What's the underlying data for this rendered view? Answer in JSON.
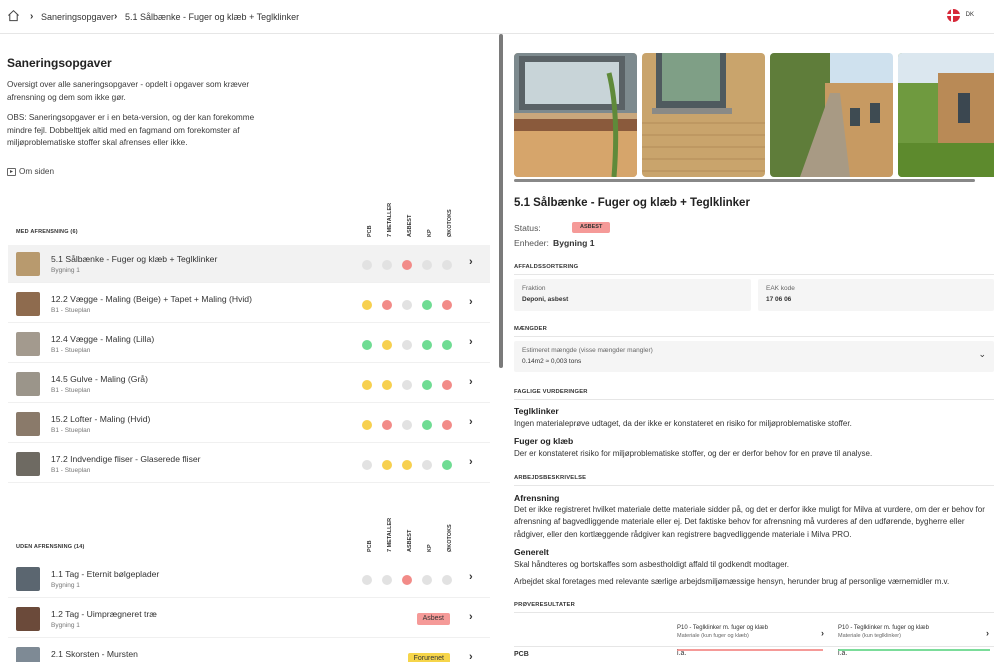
{
  "breadcrumb": {
    "home_icon": "home-icon",
    "items": [
      "Saneringsopgaver",
      "5.1 Sålbænke - Fuger og klæb + Teglklinker"
    ]
  },
  "lang": {
    "flag": "denmark-flag-icon",
    "label": "DK"
  },
  "left": {
    "title": "Saneringsopgaver",
    "intro1": "Oversigt over alle saneringsopgaver - opdelt i opgaver som kræver afrensning og dem som ikke gør.",
    "intro2": "OBS: Saneringsopgaver er i en beta-version, og der kan forekomme mindre fejl. Dobbelttjek altid med en fagmand om forekomster af miljøproblematiske stoffer skal afrenses eller ikke.",
    "about": "Om siden",
    "columns": [
      "PCB",
      "7 METALLER",
      "ASBEST",
      "KP",
      "ØKOTOKS"
    ],
    "with_cleaning": {
      "title": "MED AFRENSNING (6)",
      "rows": [
        {
          "title": "5.1 Sålbænke - Fuger og klæb + Teglklinker",
          "sub": "Bygning 1",
          "dots": [
            "gray",
            "gray",
            "red",
            "gray",
            "gray"
          ],
          "selected": true,
          "thumb": "#b89a6e"
        },
        {
          "title": "12.2 Vægge - Maling (Beige) + Tapet + Maling (Hvid)",
          "sub": "B1 - Stueplan",
          "dots": [
            "yellow",
            "red",
            "gray",
            "green",
            "red"
          ],
          "selected": false,
          "thumb": "#8e6b4e"
        },
        {
          "title": "12.4 Vægge - Maling (Lilla)",
          "sub": "B1 - Stueplan",
          "dots": [
            "green",
            "yellow",
            "gray",
            "green",
            "green"
          ],
          "selected": false,
          "thumb": "#a39a8e"
        },
        {
          "title": "14.5 Gulve - Maling (Grå)",
          "sub": "B1 - Stueplan",
          "dots": [
            "yellow",
            "yellow",
            "gray",
            "green",
            "red"
          ],
          "selected": false,
          "thumb": "#9b958a"
        },
        {
          "title": "15.2 Lofter - Maling (Hvid)",
          "sub": "B1 - Stueplan",
          "dots": [
            "yellow",
            "red",
            "gray",
            "green",
            "red"
          ],
          "selected": false,
          "thumb": "#8a7a6a"
        },
        {
          "title": "17.2 Indvendige fliser - Glaserede fliser",
          "sub": "B1 - Stueplan",
          "dots": [
            "gray",
            "yellow",
            "yellow",
            "gray",
            "green"
          ],
          "selected": false,
          "thumb": "#6e6a62"
        }
      ]
    },
    "without_cleaning": {
      "title": "UDEN AFRENSNING (14)",
      "rows": [
        {
          "title": "1.1 Tag - Eternit bølgeplader",
          "sub": "Bygning 1",
          "dots": [
            "gray",
            "gray",
            "red",
            "gray",
            "gray"
          ],
          "badge": null,
          "thumb": "#5b6670"
        },
        {
          "title": "1.2 Tag - Uimprægneret træ",
          "sub": "Bygning 1",
          "dots": [],
          "badge": "Asbest",
          "badge_color": "#f59a98",
          "thumb": "#6b4a3a"
        },
        {
          "title": "2.1 Skorsten - Mursten",
          "sub": "",
          "dots": [],
          "badge": "Forurenet",
          "badge_color": "#f6d54a",
          "thumb": "#7e8a95"
        }
      ]
    }
  },
  "right": {
    "title": "5.1 Sålbænke - Fuger og klæb + Teglklinker",
    "status_label": "Status:",
    "status_value": "ASBEST",
    "units_label": "Enheder:",
    "units_value": "Bygning 1",
    "waste_section": "AFFALDSSORTERING",
    "fraction_label": "Fraktion",
    "fraction_value": "Deponi, asbest",
    "eak_label": "EAK kode",
    "eak_value": "17 06 06",
    "amounts_section": "MÆNGDER",
    "amount_label": "Estimeret mængde (visse mængder mangler)",
    "amount_value": "0.14m2 ≈ 0,003 tons",
    "assess_section": "FAGLIGE VURDERINGER",
    "assess1_title": "Teglklinker",
    "assess1_text": "Ingen materialeprøve udtaget, da der ikke er konstateret en risiko for miljøproblematiske stoffer.",
    "assess2_title": "Fuger og klæb",
    "assess2_text": "Der er konstateret risiko for miljøproblematiske stoffer, og der er derfor behov for en prøve til analyse.",
    "work_section": "ARBEJDSBESKRIVELSE",
    "work1_title": "Afrensning",
    "work1_text": "Det er ikke registreret hvilket materiale dette materiale sidder på, og det er derfor ikke muligt for Milva at vurdere, om der er behov for afrensning af bagvedliggende materiale eller ej. Det faktiske behov for afrensning må vurderes af den udførende, bygherre eller rådgiver, eller den kortlæggende rådgiver kan registrere bagvedliggende materiale i Milva PRO.",
    "work2_title": "Generelt",
    "work2_text": "Skal håndteres og bortskaffes som asbestholdigt affald til godkendt modtager.",
    "work3_text": "Arbejdet skal foretages med relevante særlige arbejdsmiljømæssige hensyn, herunder brug af personlige værnemidler m.v.",
    "samples_section": "PRØVERESULTATER",
    "samples": [
      {
        "title": "P10 - Teglklinker m. fuger og klæb",
        "sub": "Materiale (kun fuger og klæb)",
        "color": "#f59a98"
      },
      {
        "title": "P10 - Teglklinker m. fuger og klæb",
        "sub": "Materiale (kun teglklinker)",
        "color": "#7bdc9a"
      }
    ],
    "pcb_label": "PCB",
    "pcb_values": [
      "i.a.",
      "i.a."
    ]
  },
  "colors": {
    "red": "#f28b88",
    "yellow": "#f7d04f",
    "green": "#6fdc93",
    "gray": "#e2e2e2"
  }
}
